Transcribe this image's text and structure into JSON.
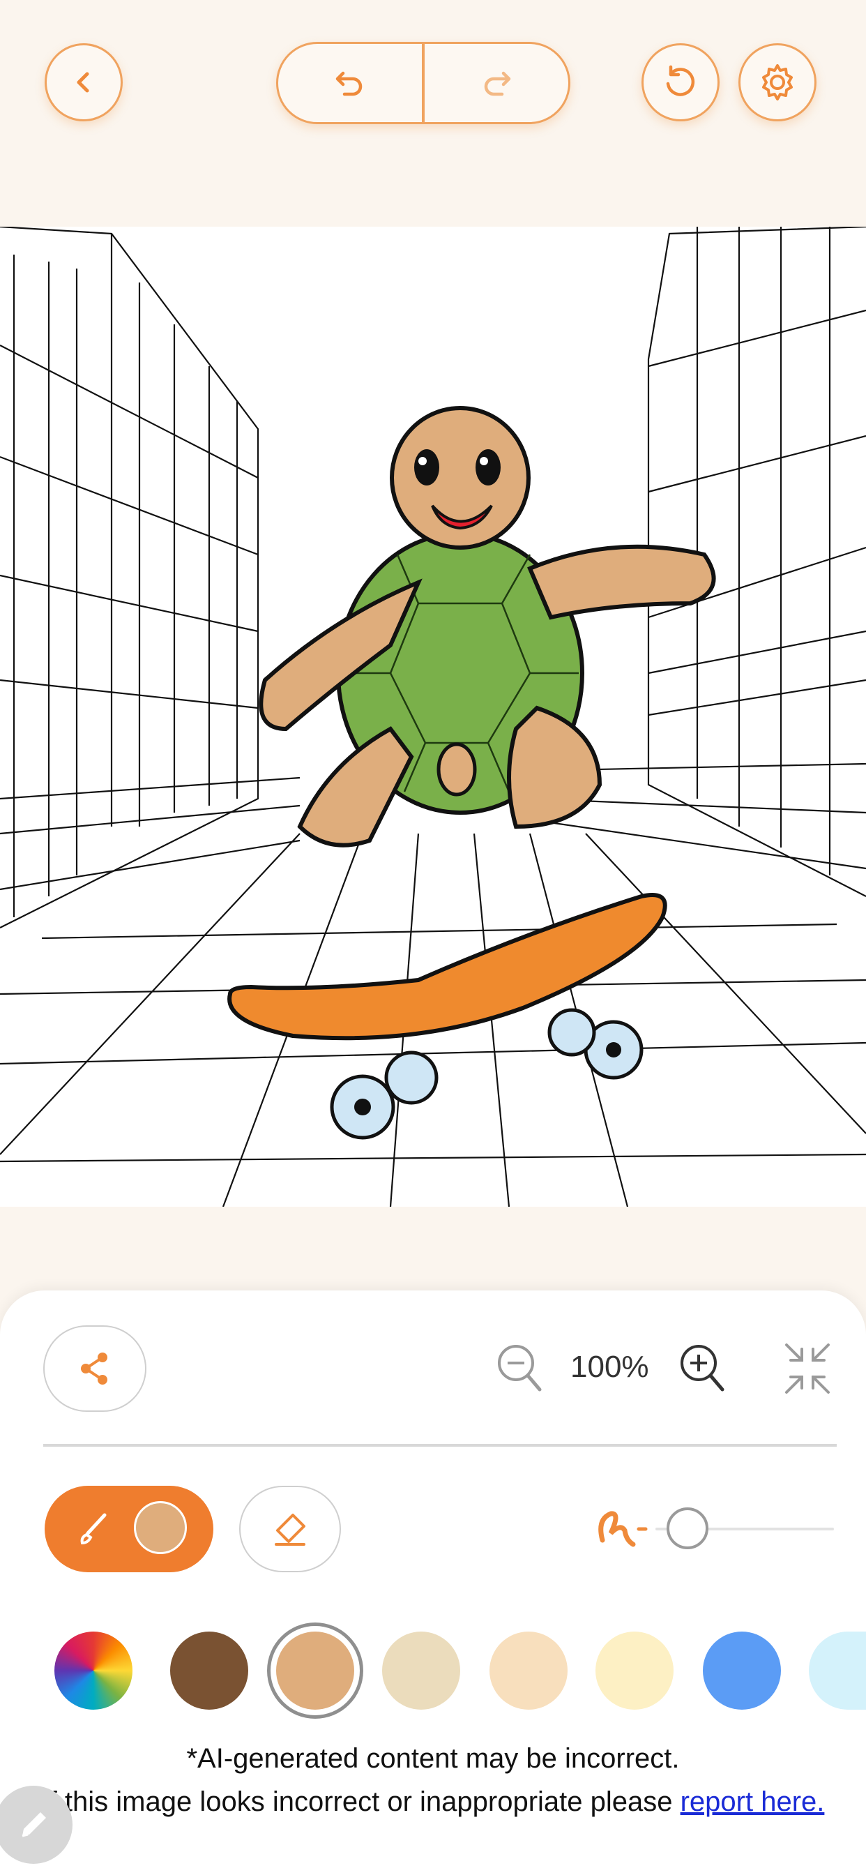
{
  "toolbar": {
    "back_icon": "chevron-left-icon",
    "undo_icon": "undo-icon",
    "redo_icon": "redo-icon",
    "reset_icon": "reset-icon",
    "settings_icon": "gear-icon",
    "accent_color": "#f0a35f"
  },
  "canvas": {
    "subject": "turtle-on-skateboard-coloring-page",
    "filled_colors": {
      "turtle_skin": "#dfad7c",
      "shell": "#7ab04a",
      "skateboard": "#ef8a2e",
      "wheels": "#cfe6f5"
    }
  },
  "controls": {
    "zoom_label": "100%",
    "share_icon": "share-icon",
    "zoom_out_icon": "zoom-out-icon",
    "zoom_in_icon": "zoom-in-icon",
    "fit_icon": "collapse-icon",
    "brush_color": "#dfad7c",
    "brush_size_fraction": 0.07
  },
  "palette": [
    {
      "name": "color-wheel",
      "color": "conic"
    },
    {
      "name": "brown",
      "color": "#7a5232"
    },
    {
      "name": "tan",
      "color": "#dfad7c",
      "selected": true
    },
    {
      "name": "beige",
      "color": "#ebdcbc"
    },
    {
      "name": "peach",
      "color": "#f8dfbd"
    },
    {
      "name": "cream",
      "color": "#fdf0c4"
    },
    {
      "name": "blue",
      "color": "#5b9cf5"
    },
    {
      "name": "light-blue",
      "color": "#d4f2fb"
    }
  ],
  "disclaimer": {
    "line1": "*AI-generated content may be incorrect.",
    "line2_prefix": "If this image looks incorrect or inappropriate please ",
    "link_text": "report here."
  }
}
